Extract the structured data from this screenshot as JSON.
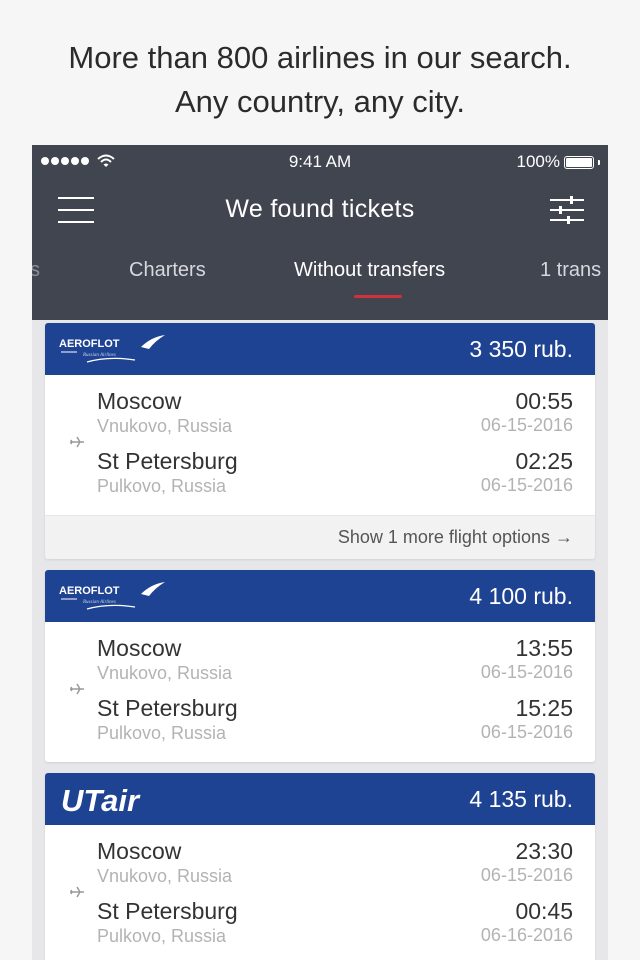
{
  "promo": {
    "line1": "More than 800 airlines in our search.",
    "line2": "Any country, any city."
  },
  "status_bar": {
    "time": "9:41 AM",
    "battery": "100%"
  },
  "header": {
    "title": "We found tickets"
  },
  "tabs": [
    {
      "label": "s"
    },
    {
      "label": "Charters"
    },
    {
      "label": "Without transfers",
      "active": true
    },
    {
      "label": "1 trans"
    }
  ],
  "colors": {
    "header_bg": "#414550",
    "card_header_bg": "#1f4393",
    "active_tab_indicator": "#d0313c"
  },
  "results": [
    {
      "airline": "AEROFLOT",
      "airline_sub": "Russian Airlines",
      "price": "3 350 rub.",
      "from": {
        "city": "Moscow",
        "airport": "Vnukovo, Russia",
        "time": "00:55",
        "date": "06-15-2016"
      },
      "to": {
        "city": "St Petersburg",
        "airport": "Pulkovo, Russia",
        "time": "02:25",
        "date": "06-15-2016"
      },
      "more": "Show 1 more flight options →"
    },
    {
      "airline": "AEROFLOT",
      "airline_sub": "Russian Airlines",
      "price": "4 100 rub.",
      "from": {
        "city": "Moscow",
        "airport": "Vnukovo, Russia",
        "time": "13:55",
        "date": "06-15-2016"
      },
      "to": {
        "city": "St Petersburg",
        "airport": "Pulkovo, Russia",
        "time": "15:25",
        "date": "06-15-2016"
      }
    },
    {
      "airline": "UTair",
      "price": "4 135 rub.",
      "from": {
        "city": "Moscow",
        "airport": "Vnukovo, Russia",
        "time": "23:30",
        "date": "06-15-2016"
      },
      "to": {
        "city": "St Petersburg",
        "airport": "Pulkovo, Russia",
        "time": "00:45",
        "date": "06-16-2016"
      }
    }
  ]
}
